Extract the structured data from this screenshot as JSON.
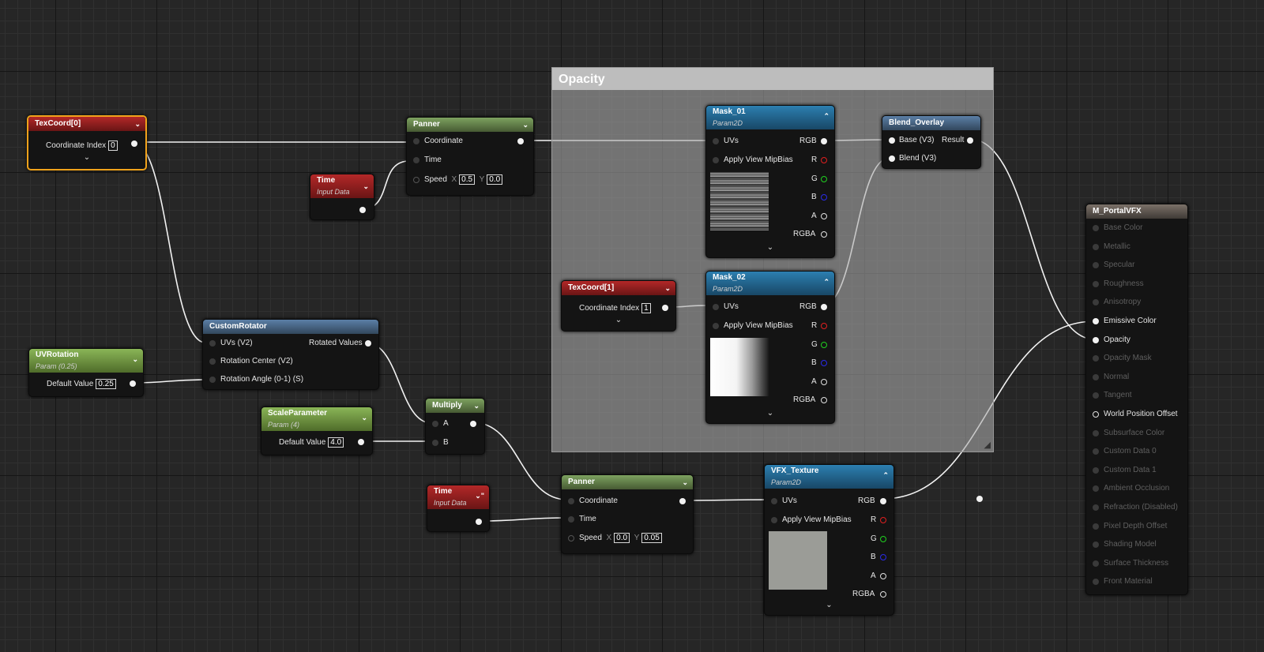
{
  "comment_box": {
    "title": "Opacity"
  },
  "nodes": {
    "texcoord0": {
      "title": "TexCoord[0]",
      "field_label": "Coordinate Index",
      "field_value": "0"
    },
    "time1": {
      "title": "Time",
      "subtitle": "Input Data"
    },
    "panner1": {
      "title": "Panner",
      "coordinate": "Coordinate",
      "time": "Time",
      "speed": "Speed",
      "x_label": "X",
      "x_value": "0.5",
      "y_label": "Y",
      "y_value": "0.0"
    },
    "mask01": {
      "title": "Mask_01",
      "subtitle": "Param2D",
      "uvs": "UVs",
      "apply": "Apply View MipBias",
      "rgb": "RGB",
      "r": "R",
      "g": "G",
      "b": "B",
      "a": "A",
      "rgba": "RGBA"
    },
    "mask02": {
      "title": "Mask_02",
      "subtitle": "Param2D",
      "uvs": "UVs",
      "apply": "Apply View MipBias",
      "rgb": "RGB",
      "r": "R",
      "g": "G",
      "b": "B",
      "a": "A",
      "rgba": "RGBA"
    },
    "blend": {
      "title": "Blend_Overlay",
      "base": "Base (V3)",
      "blend": "Blend (V3)",
      "result": "Result"
    },
    "texcoord1": {
      "title": "TexCoord[1]",
      "field_label": "Coordinate Index",
      "field_value": "1"
    },
    "rotator": {
      "title": "CustomRotator",
      "uvs": "UVs (V2)",
      "center": "Rotation Center (V2)",
      "angle": "Rotation Angle (0-1) (S)",
      "out": "Rotated Values"
    },
    "uvrotation": {
      "title": "UVRotation",
      "subtitle": "Param (0.25)",
      "field_label": "Default Value",
      "field_value": "0.25"
    },
    "scale": {
      "title": "ScaleParameter",
      "subtitle": "Param (4)",
      "field_label": "Default Value",
      "field_value": "4.0"
    },
    "multiply": {
      "title": "Multiply",
      "a": "A",
      "b": "B"
    },
    "time2": {
      "title": "Time",
      "subtitle": "Input Data"
    },
    "panner2": {
      "title": "Panner",
      "coordinate": "Coordinate",
      "time": "Time",
      "speed": "Speed",
      "x_label": "X",
      "x_value": "0.0",
      "y_label": "Y",
      "y_value": "0.05"
    },
    "vfx": {
      "title": "VFX_Texture",
      "subtitle": "Param2D",
      "uvs": "UVs",
      "apply": "Apply View MipBias",
      "rgb": "RGB",
      "r": "R",
      "g": "G",
      "b": "B",
      "a": "A",
      "rgba": "RGBA"
    },
    "material": {
      "title": "M_PortalVFX",
      "inputs": [
        "Base Color",
        "Metallic",
        "Specular",
        "Roughness",
        "Anisotropy",
        "Emissive Color",
        "Opacity",
        "Opacity Mask",
        "Normal",
        "Tangent",
        "World Position Offset",
        "Subsurface Color",
        "Custom Data 0",
        "Custom Data 1",
        "Ambient Occlusion",
        "Refraction (Disabled)",
        "Pixel Depth Offset",
        "Shading Model",
        "Surface Thickness",
        "Front Material"
      ],
      "active_inputs": [
        "Emissive Color",
        "Opacity",
        "World Position Offset"
      ]
    }
  },
  "icons": {
    "collapse": "chevron-down-icon",
    "expand": "chevron-up-icon",
    "resize": "resize-grip-icon"
  },
  "colors": {
    "selection": "#f0a21b",
    "r_pin": "#e02020",
    "g_pin": "#20d020",
    "b_pin": "#2a2ae8"
  }
}
